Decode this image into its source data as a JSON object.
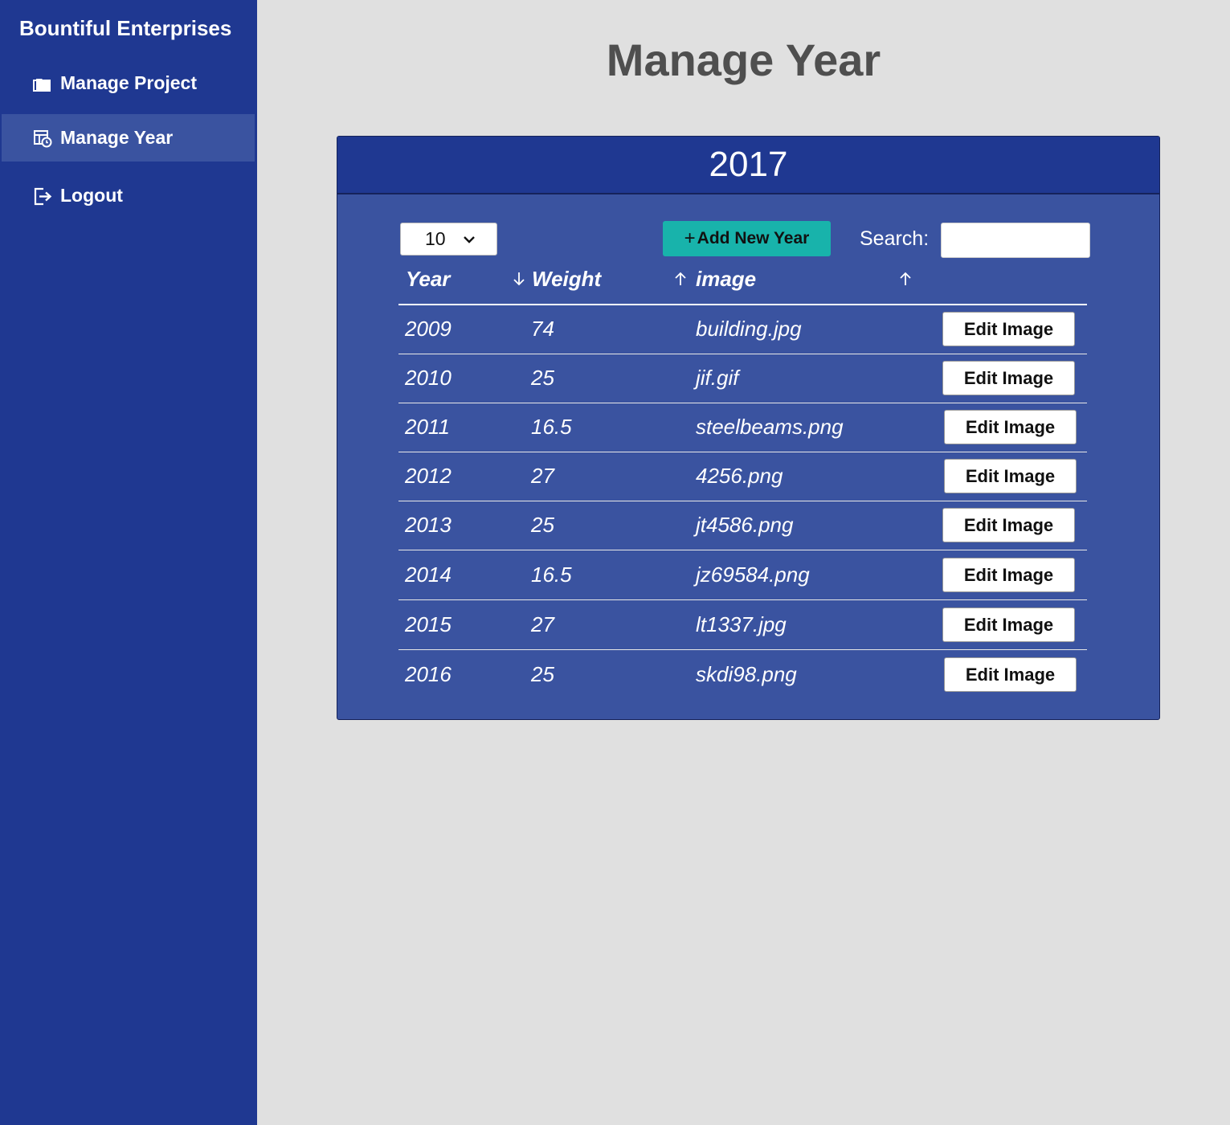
{
  "sidebar": {
    "brand": "Bountiful Enterprises",
    "items": [
      {
        "label": "Manage Project",
        "icon": "folders-icon",
        "active": false
      },
      {
        "label": "Manage Year",
        "icon": "calendar-clock-icon",
        "active": true
      },
      {
        "label": "Logout",
        "icon": "logout-icon",
        "active": false
      }
    ]
  },
  "page": {
    "title": "Manage Year"
  },
  "card": {
    "title": "2017",
    "length_select": {
      "value": "10"
    },
    "add_button": {
      "plus": "+",
      "label": "Add New Year"
    },
    "search": {
      "label": "Search:",
      "value": ""
    },
    "columns": [
      "Year",
      "Weight",
      "image"
    ],
    "rows": [
      {
        "year": "2009",
        "weight": "74",
        "image": "building.jpg",
        "action": "Edit Image"
      },
      {
        "year": "2010",
        "weight": "25",
        "image": "jif.gif",
        "action": "Edit Image"
      },
      {
        "year": "2011",
        "weight": "16.5",
        "image": "steelbeams.png",
        "action": "Edit Image"
      },
      {
        "year": "2012",
        "weight": "27",
        "image": "4256.png",
        "action": "Edit Image"
      },
      {
        "year": "2013",
        "weight": "25",
        "image": "jt4586.png",
        "action": "Edit Image"
      },
      {
        "year": "2014",
        "weight": "16.5",
        "image": "jz69584.png",
        "action": "Edit Image"
      },
      {
        "year": "2015",
        "weight": "27",
        "image": "lt1337.jpg",
        "action": "Edit Image"
      },
      {
        "year": "2016",
        "weight": "25",
        "image": "skdi98.png",
        "action": "Edit Image"
      }
    ]
  },
  "colors": {
    "sidebar_bg": "#1f3891",
    "sidebar_active": "#3a53a0",
    "card_bg": "#3a53a0",
    "card_header_bg": "#1f3891",
    "add_button_bg": "#18b3ab",
    "page_bg": "#e0e0e0",
    "title_text": "#4f4f4f"
  }
}
